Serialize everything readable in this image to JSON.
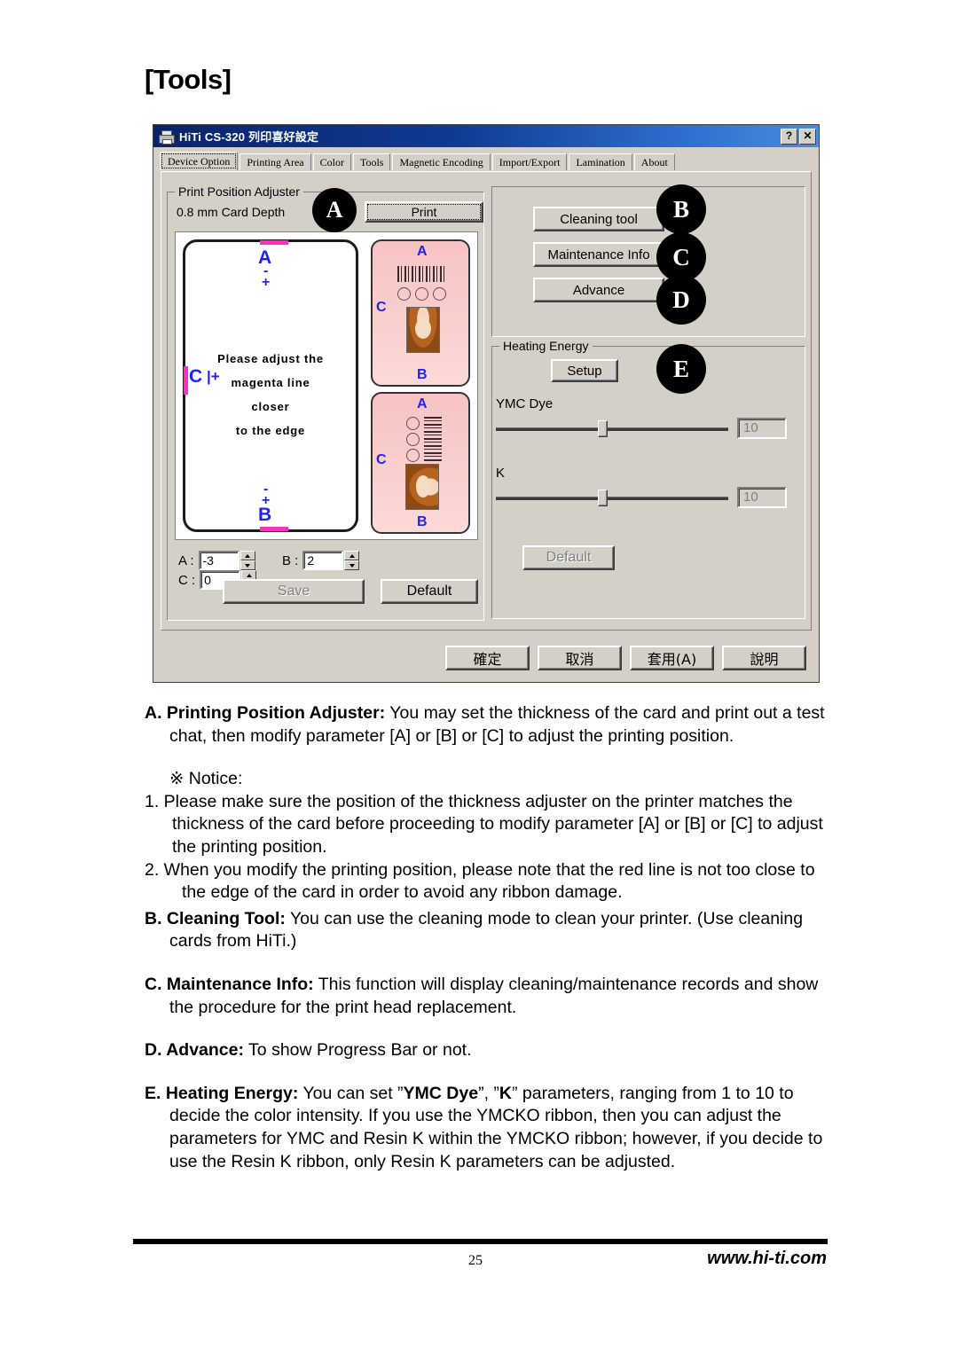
{
  "document": {
    "heading": "[Tools]",
    "page_number": "25",
    "website": "www.hi-ti.com"
  },
  "dialog": {
    "title": "HiTi CS-320 列印喜好設定",
    "help_button": "?",
    "close_button": "✕",
    "tabs": [
      {
        "label": "Device Option",
        "active": true
      },
      {
        "label": "Printing Area",
        "active": false
      },
      {
        "label": "Color",
        "active": false
      },
      {
        "label": "Tools",
        "active": false
      },
      {
        "label": "Magnetic Encoding",
        "active": false
      },
      {
        "label": "Import/Export",
        "active": false
      },
      {
        "label": "Lamination",
        "active": false
      },
      {
        "label": "About",
        "active": false
      }
    ],
    "print_position_adjuster": {
      "legend": "Print Position Adjuster",
      "card_depth": "0.8 mm Card Depth",
      "print_button": "Print",
      "preview": {
        "message_line1": "Please adjust the",
        "message_line2": "magenta line",
        "message_line3": "closer",
        "message_line4": "to the edge",
        "marker_a": "A",
        "marker_b": "B",
        "marker_c": "C",
        "minus": "-",
        "plus": "+",
        "magenta_color": "#ff2fc0",
        "marker_color": "#2222ee"
      },
      "spinners": [
        {
          "label": "A :",
          "value": "-3"
        },
        {
          "label": "B :",
          "value": "2"
        },
        {
          "label": "C :",
          "value": "0"
        }
      ],
      "save_button": "Save",
      "default_button": "Default"
    },
    "tools_group": {
      "cleaning_tool_button": "Cleaning tool",
      "maintenance_info_button": "Maintenance Info",
      "advance_button": "Advance"
    },
    "heating_energy": {
      "legend": "Heating Energy",
      "setup_button": "Setup",
      "ymc_label": "YMC Dye",
      "ymc_value": "10",
      "k_label": "K",
      "k_value": "10",
      "default_button": "Default"
    },
    "bottom_buttons": [
      {
        "label": "確定"
      },
      {
        "label": "取消"
      },
      {
        "label": "套用(A)"
      },
      {
        "label": "說明"
      }
    ]
  },
  "callouts": {
    "a": "A",
    "b": "B",
    "c": "C",
    "d": "D",
    "e": "E"
  },
  "descriptions": {
    "a_title": "A. Printing Position Adjuster:",
    "a_body": " You may set the thickness of the card and print out a test chat, then modify parameter [A] or [B] or [C] to adjust the printing position.",
    "notice_title": "※ Notice:",
    "notice_1": "1. Please make sure the position of the thickness adjuster on the printer matches the thickness of the card before proceeding to modify parameter [A] or [B] or [C] to adjust the printing position.",
    "notice_2": "2. When you modify the printing position, please note that the red line is not too close to the edge of the card in order to avoid any ribbon damage.",
    "b_title": "B. Cleaning Tool:",
    "b_body": " You can use the cleaning mode to clean your printer. (Use cleaning cards from HiTi.)",
    "c_title": "C. Maintenance Info:",
    "c_body": " This function will display cleaning/maintenance records and show the procedure for the print head replacement.",
    "d_title": "D. Advance:",
    "d_body": " To show Progress Bar or not.",
    "e_title": "E. Heating Energy:",
    "e_body_1": " You can set ”",
    "e_ymc": "YMC Dye",
    "e_body_2": "”, ”",
    "e_k": "K",
    "e_body_3": "” parameters, ranging from 1 to 10 to decide the color intensity.   If you use the YMCKO ribbon, then you can adjust the parameters for YMC and Resin K within the YMCKO ribbon; however, if you decide to use the Resin K ribbon, only Resin K parameters can be adjusted."
  }
}
